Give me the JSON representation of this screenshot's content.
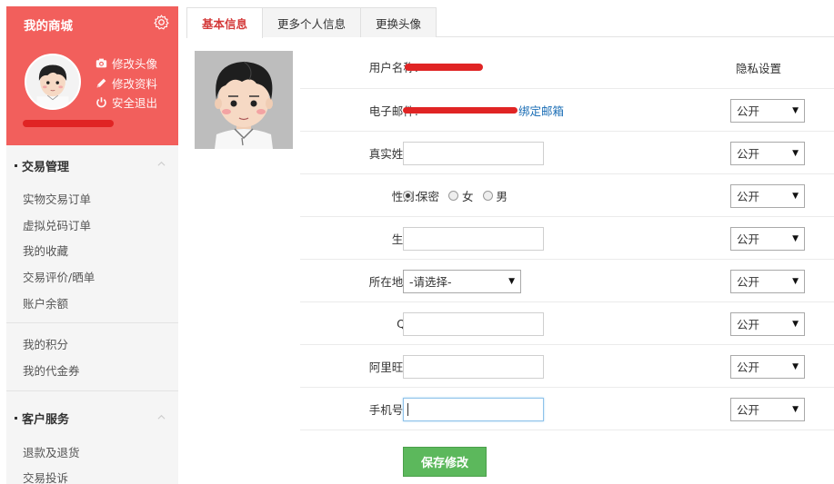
{
  "sidebar": {
    "shop_title": "我的商城",
    "header_links": [
      {
        "label": "修改头像",
        "icon": "camera-icon"
      },
      {
        "label": "修改资料",
        "icon": "pencil-icon"
      },
      {
        "label": "安全退出",
        "icon": "power-icon"
      }
    ],
    "groups": [
      {
        "title": "交易管理",
        "items": [
          "实物交易订单",
          "虚拟兑码订单",
          "我的收藏",
          "交易评价/晒单",
          "账户余额"
        ]
      },
      {
        "title": "",
        "items": [
          "我的积分",
          "我的代金券"
        ]
      },
      {
        "title": "客户服务",
        "items": [
          "退款及退货",
          "交易投诉"
        ]
      }
    ]
  },
  "tabs": [
    {
      "label": "基本信息",
      "active": true
    },
    {
      "label": "更多个人信息",
      "active": false
    },
    {
      "label": "更换头像",
      "active": false
    }
  ],
  "form": {
    "privacy_header": "隐私设置",
    "username_label": "用户名称:",
    "email_label": "电子邮件:",
    "email_bind_link": "绑定邮箱",
    "realname_label": "真实姓名:",
    "gender_label": "性别:",
    "gender_options": [
      {
        "label": "保密",
        "checked": true
      },
      {
        "label": "女",
        "checked": false
      },
      {
        "label": "男",
        "checked": false
      }
    ],
    "birthday_label": "生日:",
    "region_label": "所在地区:",
    "region_select": "-请选择-",
    "qq_label": "QQ:",
    "wangwang_label": "阿里旺旺:",
    "phone_label": "手机号码:",
    "privacy_value": "公开",
    "save_label": "保存修改"
  },
  "colors": {
    "brand_red": "#f25f5c",
    "active_tab_text": "#d43a3a",
    "save_button": "#5cb85c",
    "link": "#1a6db5"
  }
}
